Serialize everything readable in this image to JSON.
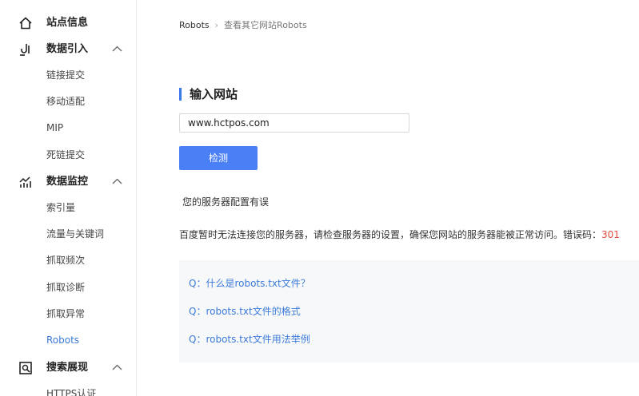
{
  "sidebar": {
    "groups": [
      {
        "icon": "home-icon",
        "label": "站点信息",
        "items": []
      },
      {
        "icon": "import-icon",
        "label": "数据引入",
        "items": [
          "链接提交",
          "移动适配",
          "MIP",
          "死链提交"
        ]
      },
      {
        "icon": "monitor-chart-icon",
        "label": "数据监控",
        "items": [
          "索引量",
          "流量与关键词",
          "抓取频次",
          "抓取诊断",
          "抓取异常",
          "Robots"
        ]
      },
      {
        "icon": "search-display-icon",
        "label": "搜索展现",
        "items": [
          "HTTPS认证"
        ]
      }
    ],
    "active_item": "Robots"
  },
  "breadcrumb": {
    "current": "Robots",
    "link": "查看其它网站Robots"
  },
  "form": {
    "title": "输入网站",
    "url_value": "www.hctpos.com",
    "detect_label": "检测"
  },
  "result": {
    "status": "您的服务器配置有误",
    "message": "百度暂时无法连接您的服务器，请检查服务器的设置，确保您网站的服务器能被正常访问。错误码：",
    "error_code": "301"
  },
  "faq": [
    "Q：什么是robots.txt文件？",
    "Q：robots.txt文件的格式",
    "Q：robots.txt文件用法举例"
  ],
  "colors": {
    "accent": "#4a7ff5",
    "link": "#3d7bd9",
    "error": "#e64c3c"
  }
}
